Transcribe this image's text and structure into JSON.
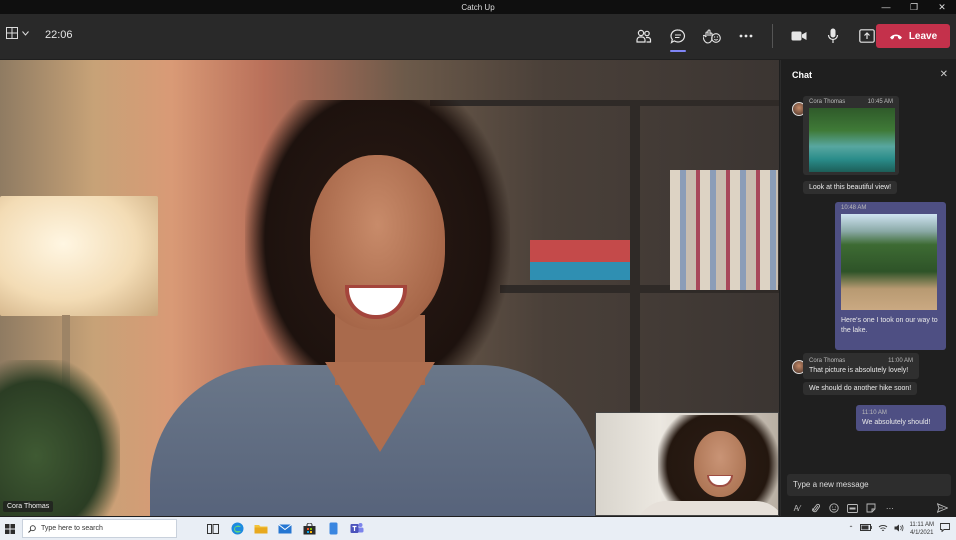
{
  "window": {
    "title": "Catch Up"
  },
  "toolbar": {
    "timer": "22:06",
    "leave_label": "Leave"
  },
  "video": {
    "participant_name": "Cora Thomas"
  },
  "chat": {
    "header": "Chat",
    "messages": [
      {
        "sender": "Cora Thomas",
        "time": "10:45 AM",
        "text": "Look at this beautiful view!"
      },
      {
        "time": "10:48 AM",
        "text": "Here's one I took on our way to the lake."
      },
      {
        "sender": "Cora Thomas",
        "time": "11:00 AM",
        "text1": "That picture is absolutely lovely!",
        "text2": "We should do another hike soon!"
      },
      {
        "time": "11:10 AM",
        "text": "We absolutely should!"
      }
    ],
    "compose_placeholder": "Type a new message"
  },
  "taskbar": {
    "search_placeholder": "Type here to search",
    "time": "11:11 AM",
    "date": "4/1/2021"
  },
  "colors": {
    "leave": "#c4314b",
    "own_bubble": "#4e4f83",
    "accent": "#7f85f5"
  }
}
